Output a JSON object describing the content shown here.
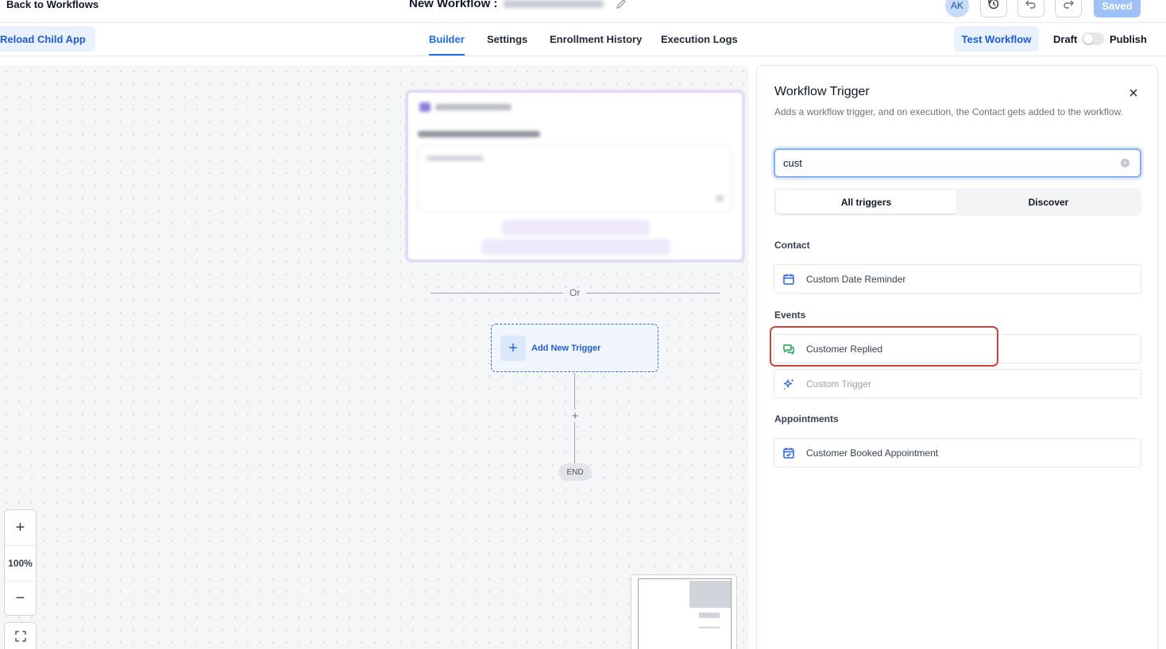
{
  "topbar": {
    "back_label": "Back to Workflows",
    "workflow_title": "New Workflow :",
    "avatar_initials": "AK",
    "saved_label": "Saved"
  },
  "subbar": {
    "reload_label": "Reload Child App",
    "tabs": [
      {
        "label": "Builder",
        "active": true
      },
      {
        "label": "Settings",
        "active": false
      },
      {
        "label": "Enrollment History",
        "active": false
      },
      {
        "label": "Execution Logs",
        "active": false
      }
    ],
    "test_label": "Test Workflow",
    "draft_label": "Draft",
    "publish_label": "Publish",
    "publish_toggle_on": false
  },
  "canvas": {
    "or_label": "Or",
    "add_trigger_label": "Add New Trigger",
    "end_label": "END",
    "zoom_level": "100%"
  },
  "panel": {
    "title": "Workflow Trigger",
    "description": "Adds a workflow trigger, and on execution, the Contact gets added to the workflow.",
    "search_value": "cust",
    "segments": [
      "All triggers",
      "Discover"
    ],
    "active_segment": "All triggers",
    "sections": [
      {
        "heading": "Contact",
        "items": [
          {
            "label": "Custom Date Reminder",
            "icon": "calendar-icon",
            "muted": false
          }
        ]
      },
      {
        "heading": "Events",
        "items": [
          {
            "label": "Customer Replied",
            "icon": "chat-bubbles-icon",
            "muted": false
          },
          {
            "label": "Custom Trigger",
            "icon": "sparkle-icon",
            "muted": true
          }
        ]
      },
      {
        "heading": "Appointments",
        "items": [
          {
            "label": "Customer Booked Appointment",
            "icon": "calendar-check-icon",
            "muted": false
          }
        ]
      }
    ]
  },
  "colors": {
    "accent": "#1d6fe8",
    "highlight": "#d0433a",
    "contact_icon": "#2563eb",
    "events_icon": "#16a34a"
  }
}
